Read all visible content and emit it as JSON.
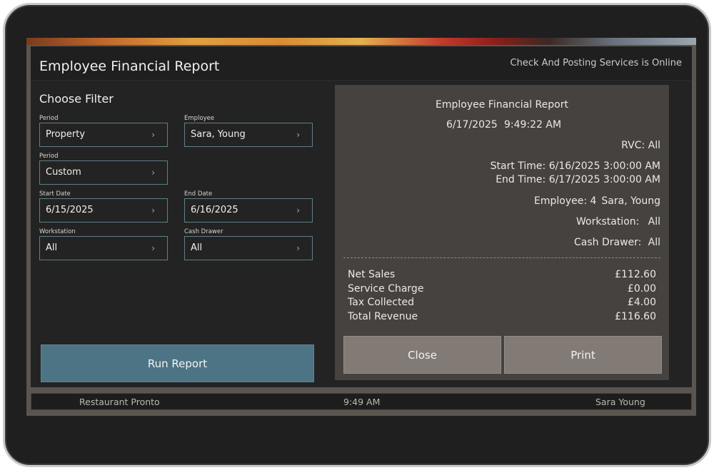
{
  "header": {
    "title": "Employee Financial Report",
    "status": "Check And Posting Services is Online"
  },
  "filters": {
    "title": "Choose Filter",
    "fields": {
      "period1": {
        "label": "Period",
        "value": "Property"
      },
      "employee": {
        "label": "Employee",
        "value": "Sara, Young"
      },
      "period2": {
        "label": "Period",
        "value": "Custom"
      },
      "start_date": {
        "label": "Start Date",
        "value": "6/15/2025"
      },
      "end_date": {
        "label": "End Date",
        "value": "6/16/2025"
      },
      "workstation": {
        "label": "Workstation",
        "value": "All"
      },
      "cash_drawer": {
        "label": "Cash Drawer",
        "value": "All"
      }
    },
    "chevron": "›",
    "run_label": "Run Report"
  },
  "report": {
    "title": "Employee Financial Report",
    "date": "6/17/2025",
    "time": "9:49:22 AM",
    "rvc": "RVC: All",
    "start_time": "Start Time: 6/16/2025 3:00:00 AM",
    "end_time": "End Time: 6/17/2025 3:00:00 AM",
    "employee_label": "Employee: 4",
    "employee_name": "Sara, Young",
    "workstation_label": "Workstation:",
    "workstation_value": "All",
    "cash_drawer_label": "Cash Drawer:",
    "cash_drawer_value": "All",
    "totals": [
      {
        "label": "Net Sales",
        "value": "£112.60"
      },
      {
        "label": "Service Charge",
        "value": "£0.00"
      },
      {
        "label": "Tax Collected",
        "value": "£4.00"
      },
      {
        "label": "Total Revenue",
        "value": "£116.60"
      }
    ],
    "close_label": "Close",
    "print_label": "Print"
  },
  "footer": {
    "location": "Restaurant Pronto",
    "time": "9:49 AM",
    "user": "Sara Young"
  },
  "colors": {
    "accent": "#4c7484",
    "button_gray": "#817a75",
    "panel": "#232323",
    "report_bg": "#45423f"
  }
}
